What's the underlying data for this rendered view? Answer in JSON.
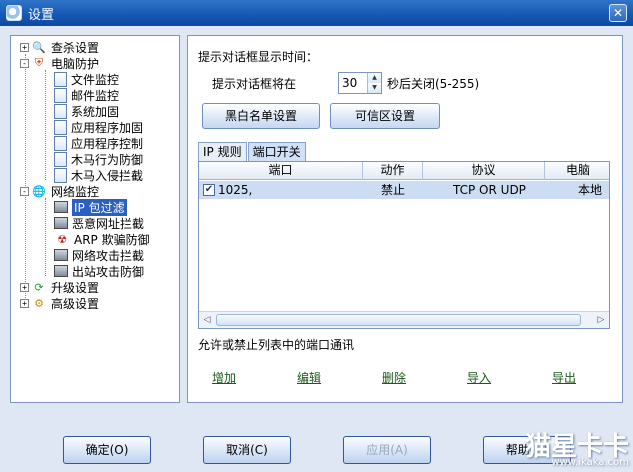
{
  "window": {
    "title": "设置"
  },
  "tree": {
    "items": [
      {
        "label": "查杀设置",
        "icon": "search-icon",
        "expander": "+"
      },
      {
        "label": "电脑防护",
        "icon": "shield-icon",
        "expander": "-"
      },
      {
        "label": "文件监控",
        "icon": "document-icon"
      },
      {
        "label": "邮件监控",
        "icon": "document-icon"
      },
      {
        "label": "系统加固",
        "icon": "document-icon"
      },
      {
        "label": "应用程序加固",
        "icon": "document-icon"
      },
      {
        "label": "应用程序控制",
        "icon": "document-icon"
      },
      {
        "label": "木马行为防御",
        "icon": "document-icon"
      },
      {
        "label": "木马入侵拦截",
        "icon": "document-icon"
      },
      {
        "label": "网络监控",
        "icon": "globe-icon",
        "expander": "-"
      },
      {
        "label": "IP 包过滤",
        "icon": "monitor-icon",
        "selected": true
      },
      {
        "label": "恶意网址拦截",
        "icon": "monitor-icon"
      },
      {
        "label": "ARP 欺骗防御",
        "icon": "danger-icon"
      },
      {
        "label": "网络攻击拦截",
        "icon": "monitor-icon"
      },
      {
        "label": "出站攻击防御",
        "icon": "monitor-icon"
      },
      {
        "label": "升级设置",
        "icon": "update-icon",
        "expander": "+"
      },
      {
        "label": "高级设置",
        "icon": "gear-icon",
        "expander": "+"
      }
    ]
  },
  "panel": {
    "dialog_time_label": "提示对话框显示时间：",
    "prompt_prefix": "提示对话框将在",
    "seconds_value": "30",
    "prompt_suffix": "秒后关闭(5-255)",
    "blacklist_button": "黑白名单设置",
    "trusted_button": "可信区设置",
    "tabs": [
      "IP 规则",
      "端口开关"
    ],
    "columns": [
      "端口",
      "动作",
      "协议",
      "电脑"
    ],
    "rows": [
      {
        "checked": true,
        "port": "1025,",
        "action": "禁止",
        "protocol": "TCP OR UDP",
        "computer": "本地"
      }
    ],
    "hint": "允许或禁止列表中的端口通讯",
    "actions": [
      "增加",
      "编辑",
      "删除",
      "导入",
      "导出"
    ]
  },
  "buttons": {
    "ok": "确定(O)",
    "cancel": "取消(C)",
    "apply": "应用(A)",
    "help": "帮助(H)"
  },
  "watermark": {
    "brand": "猫星卡卡",
    "url": "www.ikaka.com"
  }
}
